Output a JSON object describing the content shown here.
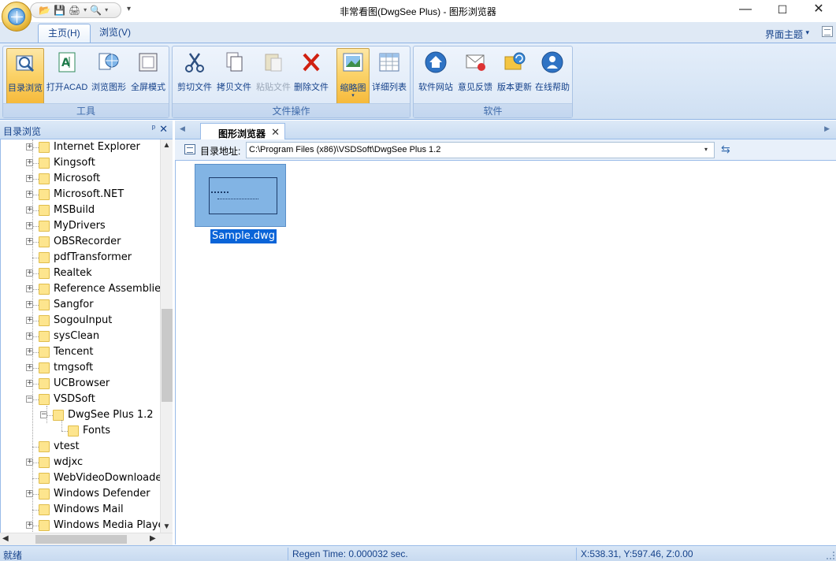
{
  "window": {
    "title": "非常看图(DwgSee Plus) - 图形浏览器",
    "minimize_label": "—",
    "maximize_label": "☐",
    "close_label": "✕"
  },
  "quick_access": {
    "items": [
      "📂",
      "💾",
      "🖨",
      "▾",
      "🔍",
      "▾"
    ],
    "dropdown": "▾"
  },
  "ribbon": {
    "tabs": [
      {
        "label": "主页(H)",
        "active": true
      },
      {
        "label": "浏览(V)",
        "active": false
      }
    ],
    "theme_label": "界面主题",
    "theme_arrow": "▾",
    "groups": [
      {
        "label": "工具",
        "buttons": [
          {
            "label": "目录浏览",
            "icon": "folder-browse-icon",
            "selected": true
          },
          {
            "label": "打开ACAD",
            "icon": "acad-icon"
          },
          {
            "label": "浏览图形",
            "icon": "dwg-globe-icon"
          },
          {
            "label": "全屏模式",
            "icon": "fullscreen-icon"
          }
        ]
      },
      {
        "label": "文件操作",
        "buttons": [
          {
            "label": "剪切文件",
            "icon": "scissors-icon"
          },
          {
            "label": "拷贝文件",
            "icon": "copy-icon"
          },
          {
            "label": "粘贴文件",
            "icon": "paste-icon",
            "disabled": true
          },
          {
            "label": "删除文件",
            "icon": "delete-icon"
          },
          {
            "label": "缩略图",
            "icon": "thumbnail-icon",
            "selected": true,
            "dropdown": "▾"
          },
          {
            "label": "详细列表",
            "icon": "list-icon"
          }
        ]
      },
      {
        "label": "软件",
        "buttons": [
          {
            "label": "软件网站",
            "icon": "home-icon"
          },
          {
            "label": "意见反馈",
            "icon": "feedback-icon"
          },
          {
            "label": "版本更新",
            "icon": "update-icon"
          },
          {
            "label": "在线帮助",
            "icon": "help-icon"
          }
        ]
      }
    ]
  },
  "left_pane": {
    "title": "目录浏览",
    "pin": "ᵖ",
    "close": "✕",
    "tree": [
      {
        "label": "Internet Explorer",
        "level": 1,
        "expander": "+"
      },
      {
        "label": "Kingsoft",
        "level": 1,
        "expander": "+"
      },
      {
        "label": "Microsoft",
        "level": 1,
        "expander": "+"
      },
      {
        "label": "Microsoft.NET",
        "level": 1,
        "expander": "+"
      },
      {
        "label": "MSBuild",
        "level": 1,
        "expander": "+"
      },
      {
        "label": "MyDrivers",
        "level": 1,
        "expander": "+"
      },
      {
        "label": "OBSRecorder",
        "level": 1,
        "expander": "+"
      },
      {
        "label": "pdfTransformer",
        "level": 1,
        "expander": ""
      },
      {
        "label": "Realtek",
        "level": 1,
        "expander": "+"
      },
      {
        "label": "Reference Assemblies",
        "level": 1,
        "expander": "+"
      },
      {
        "label": "Sangfor",
        "level": 1,
        "expander": "+"
      },
      {
        "label": "SogouInput",
        "level": 1,
        "expander": "+"
      },
      {
        "label": "sysClean",
        "level": 1,
        "expander": "+"
      },
      {
        "label": "Tencent",
        "level": 1,
        "expander": "+"
      },
      {
        "label": "tmgsoft",
        "level": 1,
        "expander": "+"
      },
      {
        "label": "UCBrowser",
        "level": 1,
        "expander": "+"
      },
      {
        "label": "VSDSoft",
        "level": 1,
        "expander": "−"
      },
      {
        "label": "DwgSee Plus 1.2",
        "level": 2,
        "expander": "−"
      },
      {
        "label": "Fonts",
        "level": 3,
        "expander": ""
      },
      {
        "label": "vtest",
        "level": 1,
        "expander": ""
      },
      {
        "label": "wdjxc",
        "level": 1,
        "expander": "+"
      },
      {
        "label": "WebVideoDownloader",
        "level": 1,
        "expander": ""
      },
      {
        "label": "Windows Defender",
        "level": 1,
        "expander": "+"
      },
      {
        "label": "Windows Mail",
        "level": 1,
        "expander": ""
      },
      {
        "label": "Windows Media Player",
        "level": 1,
        "expander": "+"
      }
    ],
    "scroll_up": "▲",
    "scroll_down": "▼",
    "scroll_left": "◀",
    "scroll_right": "▶"
  },
  "document": {
    "tab_label": "图形浏览器",
    "tab_close": "✕",
    "nav_left": "◀",
    "nav_right": "▶",
    "address_label": "目录地址:",
    "address_value": "C:\\Program Files (x86)\\VSDSoft\\DwgSee Plus 1.2",
    "address_dropdown": "▾",
    "refresh_icon": "⇆",
    "files": [
      {
        "name": "Sample.dwg",
        "selected": true
      }
    ]
  },
  "status": {
    "ready": "就绪",
    "regen": "Regen Time: 0.000032 sec.",
    "coords": "X:538.31, Y:597.46, Z:0.00"
  }
}
